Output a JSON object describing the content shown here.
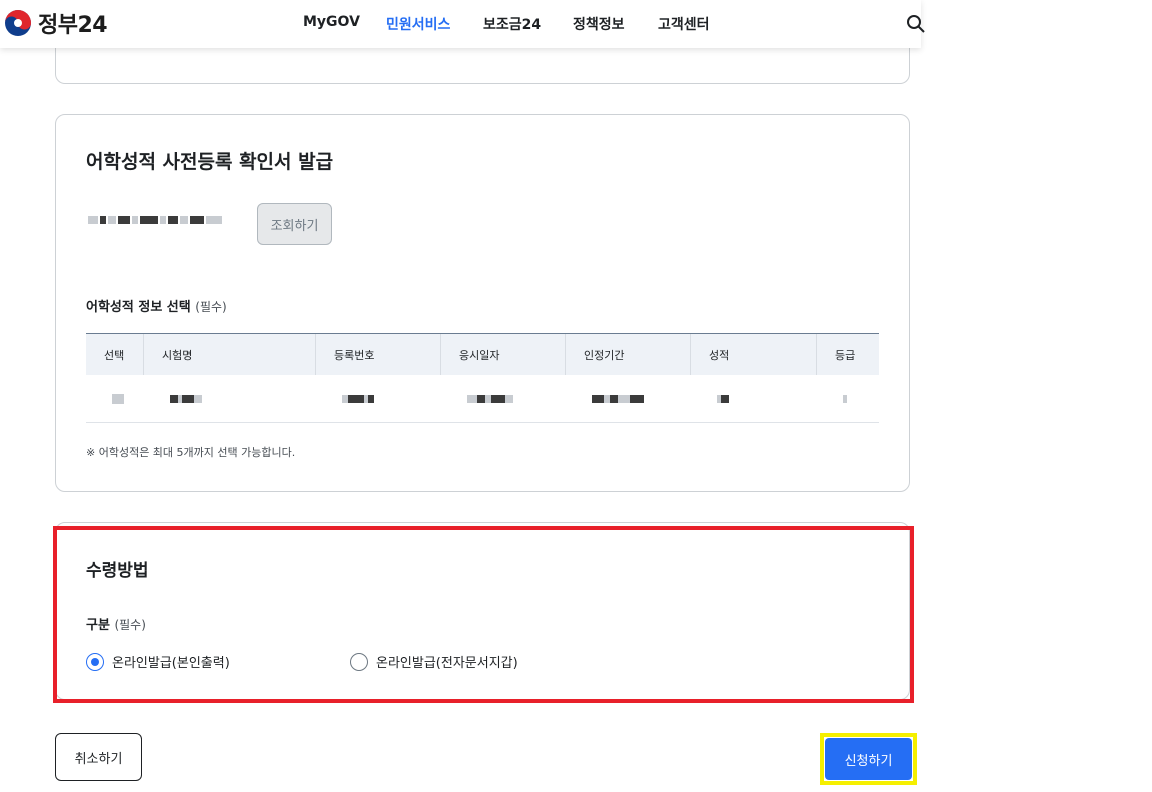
{
  "header": {
    "logo_text": "정부24",
    "nav": [
      "MyGOV",
      "민원서비스",
      "보조금24",
      "정책정보",
      "고객센터"
    ],
    "active_nav": "민원서비스"
  },
  "card1": {
    "title": "어학성적 사전등록 확인서 발급",
    "lookup_button": "조회하기",
    "section_label": "어학성적 정보 선택",
    "required_label": "(필수)",
    "table": {
      "headers": [
        "선택",
        "시험명",
        "등록번호",
        "응시일자",
        "인정기간",
        "성적",
        "등급"
      ]
    },
    "note": "※ 어학성적은 최대 5개까지 선택 가능합니다."
  },
  "card2": {
    "title": "수령방법",
    "section_label": "구분",
    "required_label": "(필수)",
    "options": [
      {
        "label": "온라인발급(본인출력)",
        "checked": true
      },
      {
        "label": "온라인발급(전자문서지갑)",
        "checked": false
      }
    ]
  },
  "buttons": {
    "cancel": "취소하기",
    "apply": "신청하기"
  },
  "colors": {
    "accent": "#256ef4",
    "highlight_red": "#e8202a",
    "highlight_yellow": "#f5ef00"
  }
}
